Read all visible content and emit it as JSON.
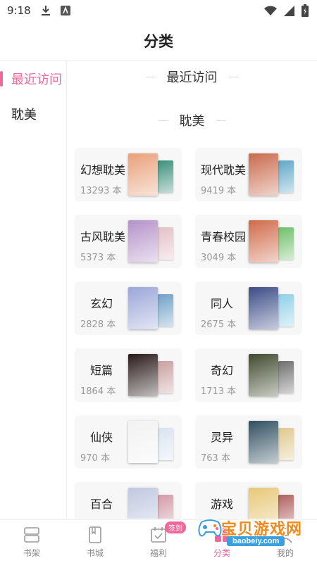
{
  "status_bar": {
    "time": "9:18",
    "icons": [
      "download-icon",
      "app-icon",
      "wifi-icon",
      "signal-icon",
      "battery-icon"
    ]
  },
  "header": {
    "title": "分类"
  },
  "sidebar": {
    "items": [
      {
        "label": "最近访问",
        "active": true
      },
      {
        "label": "耽美",
        "active": false
      }
    ]
  },
  "main": {
    "sections": [
      {
        "title": "最近访问"
      },
      {
        "title": "耽美"
      }
    ],
    "categories": [
      {
        "name": "幻想耽美",
        "count": "13293 本",
        "front": "#e9a07a",
        "back": "#3a8f7a"
      },
      {
        "name": "现代耽美",
        "count": "9419 本",
        "front": "#c96a4c",
        "back": "#5fa6c8"
      },
      {
        "name": "古风耽美",
        "count": "5373 本",
        "front": "#b592c9",
        "back": "#e4c0c8"
      },
      {
        "name": "青春校园",
        "count": "3049 本",
        "front": "#d06a4a",
        "back": "#6fbf6a"
      },
      {
        "name": "玄幻",
        "count": "2828 本",
        "front": "#9aa6d8",
        "back": "#6fa0c8"
      },
      {
        "name": "同人",
        "count": "2675 本",
        "front": "#3b4c86",
        "back": "#8fd0e8"
      },
      {
        "name": "短篇",
        "count": "1864 本",
        "front": "#2a1a1a",
        "back": "#c9a0a0"
      },
      {
        "name": "奇幻",
        "count": "1713 本",
        "front": "#3f4a2e",
        "back": "#6e6e6e"
      },
      {
        "name": "仙侠",
        "count": "970 本",
        "front": "#f2f2f2",
        "back": "#d8e4f0"
      },
      {
        "name": "灵异",
        "count": "763 本",
        "front": "#2f4f5f",
        "back": "#e0c890"
      },
      {
        "name": "百合",
        "count": "",
        "front": "#c0c8e0",
        "back": "#d49aa8"
      },
      {
        "name": "游戏",
        "count": "",
        "front": "#e8c878",
        "back": "#b06060"
      }
    ]
  },
  "bottom_nav": {
    "items": [
      {
        "label": "书架",
        "icon": "bookshelf-icon"
      },
      {
        "label": "书城",
        "icon": "bookstore-icon"
      },
      {
        "label": "福利",
        "icon": "calendar-gift-icon",
        "badge": "签到"
      },
      {
        "label": "分类",
        "icon": "category-icon",
        "active": true
      },
      {
        "label": "我的",
        "icon": "profile-icon"
      }
    ]
  },
  "watermark": {
    "text": "宝贝游戏网",
    "url": "baobeiy.com"
  },
  "colors": {
    "accent": "#f0679a",
    "card_bg": "#f7f7f7",
    "count_text": "#999999"
  }
}
